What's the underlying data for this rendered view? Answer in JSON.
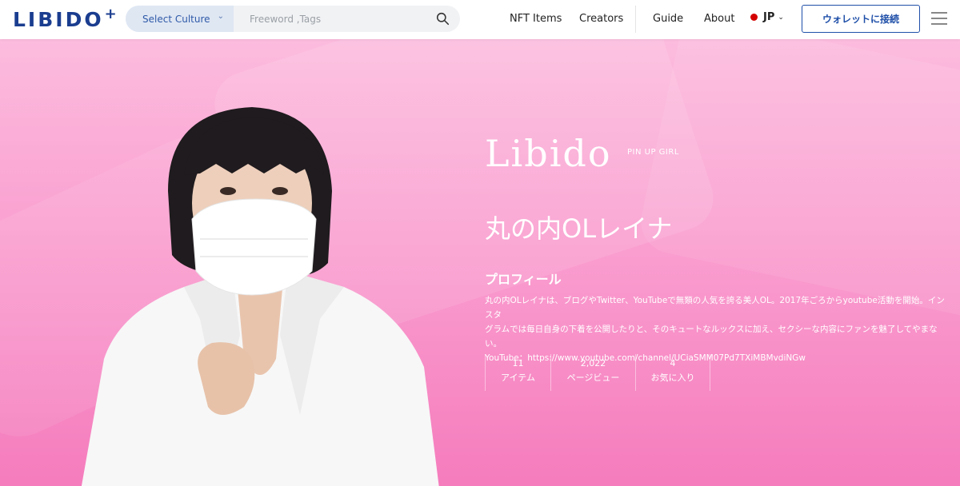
{
  "header": {
    "logo": "LIBIDO",
    "logo_plus": "+",
    "search": {
      "culture_label": "Select Culture",
      "placeholder": "Freeword ,Tags"
    },
    "nav": {
      "nft_items": "NFT Items",
      "creators": "Creators",
      "guide": "Guide",
      "about": "About"
    },
    "language": "JP",
    "wallet_button": "ウォレットに接続",
    "colors": {
      "brand": "#1a3d8f",
      "accent": "#1f4fa8"
    }
  },
  "hero": {
    "brand": "Libido",
    "brand_sub": "PIN UP GIRL",
    "creator_name": "丸の内OLレイナ",
    "profile_heading": "プロフィール",
    "profile_line1": "丸の内OLレイナは、ブログやTwitter、YouTubeで無類の人気を誇る美人OL。2017年ごろからyoutube活動を開始。インスタ",
    "profile_line2": "グラムでは毎日自身の下着を公開したりと、そのキュートなルックスに加え、セクシーな内容にファンを魅了してやまない。",
    "profile_line3": "YouTube：https://www.youtube.com/channel/UCiaSMM07Pd7TXiMBMvdiNGw",
    "stats": [
      {
        "value": "11",
        "label": "アイテム"
      },
      {
        "value": "2,022",
        "label": "ページビュー"
      },
      {
        "value": "4",
        "label": "お気に入り"
      }
    ],
    "colors": {
      "background_top": "#fcbcde",
      "background_bottom": "#f57cbd"
    }
  }
}
